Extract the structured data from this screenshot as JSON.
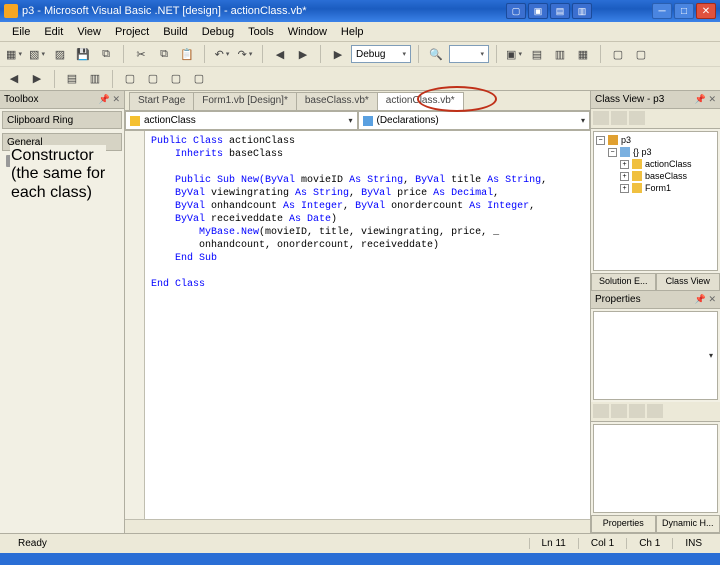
{
  "titlebar": {
    "title": "p3 - Microsoft Visual Basic .NET [design] - actionClass.vb*"
  },
  "menu": {
    "file": "Eile",
    "edit": "Edit",
    "view": "View",
    "project": "Project",
    "build": "Build",
    "debug": "Debug",
    "tools": "Tools",
    "window": "Window",
    "help": "Help"
  },
  "toolbar": {
    "config": "Debug"
  },
  "toolbox": {
    "title": "Toolbox",
    "section1": "Clipboard Ring",
    "section2": "General",
    "item1": "Pointer"
  },
  "doc_tabs": {
    "t0": "Start Page",
    "t1": "Form1.vb [Design]*",
    "t2": "baseClass.vb*",
    "t3": "actionClass.vb*"
  },
  "dropdowns": {
    "left": "actionClass",
    "right": "(Declarations)"
  },
  "code": {
    "l1a": "Public Class",
    "l1b": " actionClass",
    "l2a": "    Inherits",
    "l2b": " baseClass",
    "l3": "",
    "l4a": "    Public Sub New",
    "l4b": "(ByVal",
    "l4c": " movieID ",
    "l4d": "As String",
    "l4e": ", ",
    "l4f": "ByVal",
    "l4g": " title ",
    "l4h": "As String",
    "l4i": ",",
    "l5a": "    ByVal",
    "l5b": " viewingrating ",
    "l5c": "As String",
    "l5d": ", ",
    "l5e": "ByVal",
    "l5f": " price ",
    "l5g": "As Decimal",
    "l5h": ",",
    "l6a": "    ByVal",
    "l6b": " onhandcount ",
    "l6c": "As Integer",
    "l6d": ", ",
    "l6e": "ByVal",
    "l6f": " onordercount ",
    "l6g": "As Integer",
    "l6h": ",",
    "l7a": "    ByVal",
    "l7b": " receiveddate ",
    "l7c": "As Date",
    "l7d": ")",
    "l8a": "        MyBase.New",
    "l8b": "(movieID, title, viewingrating, price, _",
    "l9": "        onhandcount, onordercount, receiveddate)",
    "l10": "    End Sub",
    "l11": "",
    "l12": "End Class"
  },
  "tree": {
    "root": "p3",
    "n1": "{} p3",
    "n2": "actionClass",
    "n3": "baseClass",
    "n4": "Form1"
  },
  "tabs": {
    "solution": "Solution E...",
    "classview": "Class View",
    "properties": "Properties",
    "dynhelp": "Dynamic H..."
  },
  "right_head": {
    "classview": "Class View - p3",
    "properties": "Properties"
  },
  "status": {
    "ready": "Ready",
    "ln": "Ln 11",
    "col": "Col 1",
    "ch": "Ch 1",
    "ins": "INS"
  },
  "annotation": {
    "l1": "Constructor",
    "l2": "(the same for",
    "l3": "each class)"
  }
}
